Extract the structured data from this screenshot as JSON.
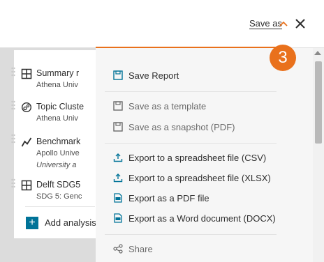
{
  "header": {
    "save_as_label": "Save as"
  },
  "panel": {
    "items": [
      {
        "title": "Summary r",
        "subtitle": "Athena Univ",
        "subtitle2": ""
      },
      {
        "title": "Topic Cluste",
        "subtitle": "Athena Univ",
        "subtitle2": ""
      },
      {
        "title": "Benchmark",
        "subtitle": "Apollo Unive",
        "subtitle2": "University a"
      },
      {
        "title": "Delft SDG5",
        "subtitle": "SDG 5: Genc",
        "subtitle2": ""
      }
    ],
    "add_label": "Add analysis"
  },
  "menu": {
    "save_report": "Save Report",
    "save_template": "Save as a template",
    "save_snapshot": "Save as a snapshot (PDF)",
    "export_csv": "Export to a spreadsheet file (CSV)",
    "export_xlsx": "Export to a spreadsheet file (XLSX)",
    "export_pdf": "Export as a PDF file",
    "export_docx": "Export as a Word document (DOCX)",
    "share": "Share"
  },
  "badge": {
    "number": "3"
  },
  "colors": {
    "accent": "#e9711c",
    "primary": "#007398",
    "overlay": "#dcdcdc"
  }
}
